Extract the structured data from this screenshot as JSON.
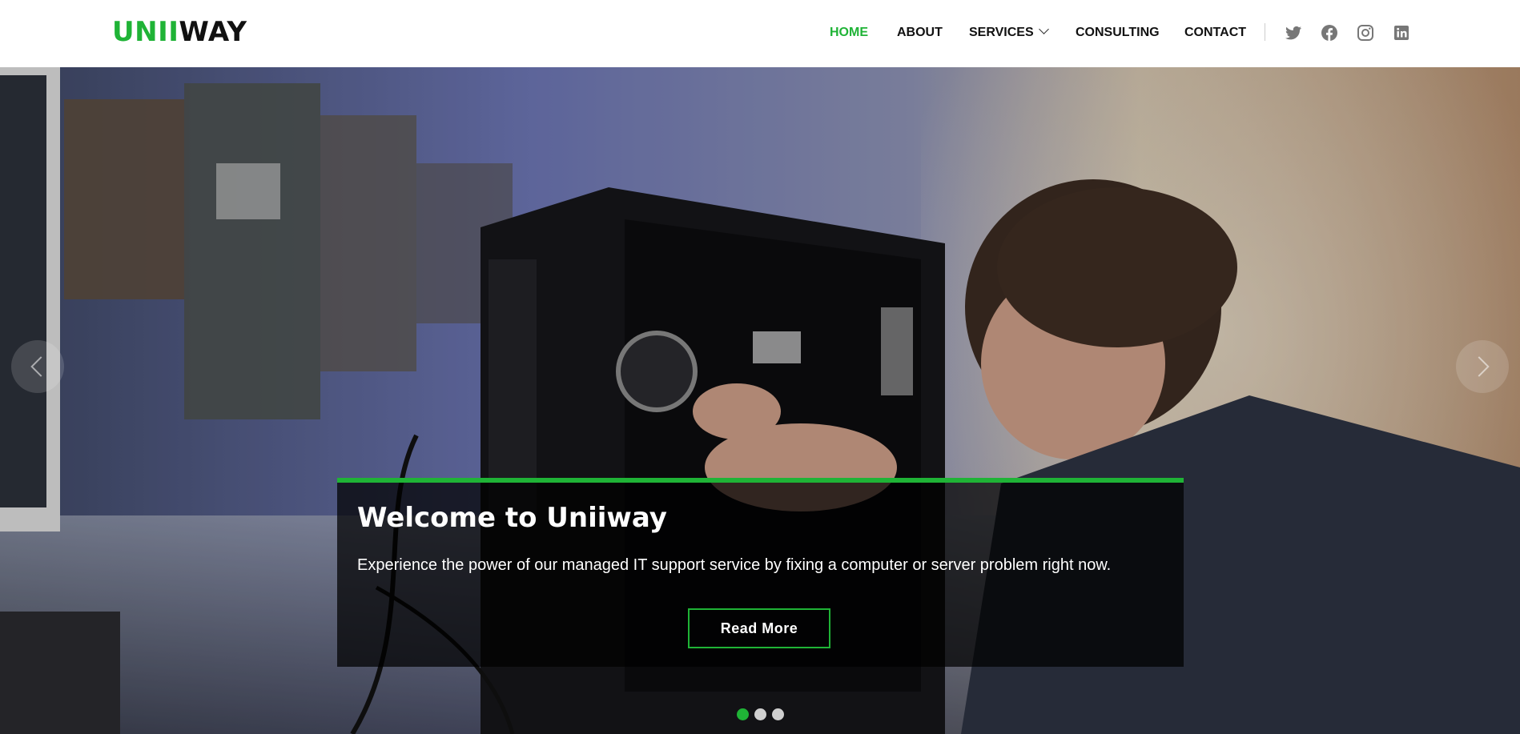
{
  "header": {
    "logo_part1": "UNII",
    "logo_part2": "WAY",
    "nav": [
      {
        "label": "HOME",
        "active": true
      },
      {
        "label": "ABOUT"
      },
      {
        "label": "SERVICES"
      },
      {
        "label": "CONSULTING"
      },
      {
        "label": "CONTACT"
      }
    ],
    "social": [
      "twitter-icon",
      "facebook-icon",
      "instagram-icon",
      "linkedin-icon"
    ]
  },
  "hero": {
    "title": "Welcome to Uniiway",
    "text": "Experience the power of our managed IT support service by fixing a computer or server problem right now.",
    "button": "Read More",
    "slides_count": 3,
    "active_slide": 1
  },
  "colors": {
    "accent": "#1fb336",
    "text_dark": "#111111"
  }
}
